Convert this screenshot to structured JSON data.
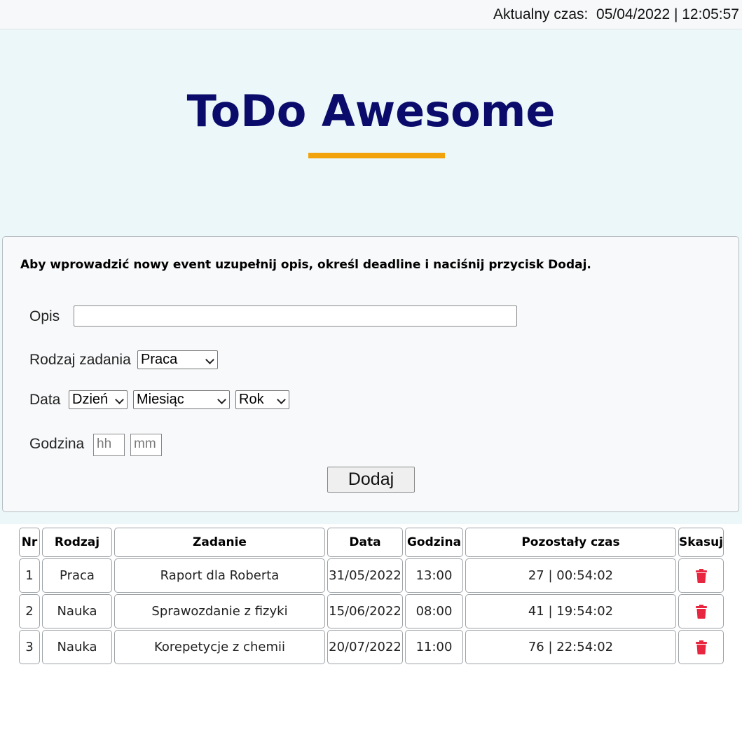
{
  "header": {
    "clock_text": "Aktualny czas:  05/04/2022 | 12:05:57"
  },
  "hero": {
    "title": "ToDo Awesome",
    "accent_color": "#f2a30c",
    "title_color": "#0b0b6b"
  },
  "form": {
    "instruction": "Aby wprowadzić nowy event uzupełnij opis, określ deadline i naciśnij przycisk Dodaj.",
    "description_label": "Opis",
    "description_value": "",
    "type_label": "Rodzaj zadania",
    "type_selected": "Praca",
    "date_label": "Data",
    "day_selected": "Dzień",
    "month_selected": "Miesiąc",
    "year_selected": "Rok",
    "time_label": "Godzina",
    "hour_placeholder": "hh",
    "minute_placeholder": "mm",
    "add_button": "Dodaj"
  },
  "table": {
    "headers": [
      "Nr",
      "Rodzaj",
      "Zadanie",
      "Data",
      "Godzina",
      "Pozostały czas",
      "Skasuj"
    ],
    "rows": [
      {
        "nr": "1",
        "type": "Praca",
        "task": "Raport dla Roberta",
        "date": "31/05/2022",
        "time": "13:00",
        "remaining": "27 | 00:54:02",
        "delete_icon": "trash-icon"
      },
      {
        "nr": "2",
        "type": "Nauka",
        "task": "Sprawozdanie z fizyki",
        "date": "15/06/2022",
        "time": "08:00",
        "remaining": "41 | 19:54:02",
        "delete_icon": "trash-icon"
      },
      {
        "nr": "3",
        "type": "Nauka",
        "task": "Korepetycje z chemii",
        "date": "20/07/2022",
        "time": "11:00",
        "remaining": "76 | 22:54:02",
        "delete_icon": "trash-icon"
      }
    ],
    "delete_color": "#e8263f"
  }
}
